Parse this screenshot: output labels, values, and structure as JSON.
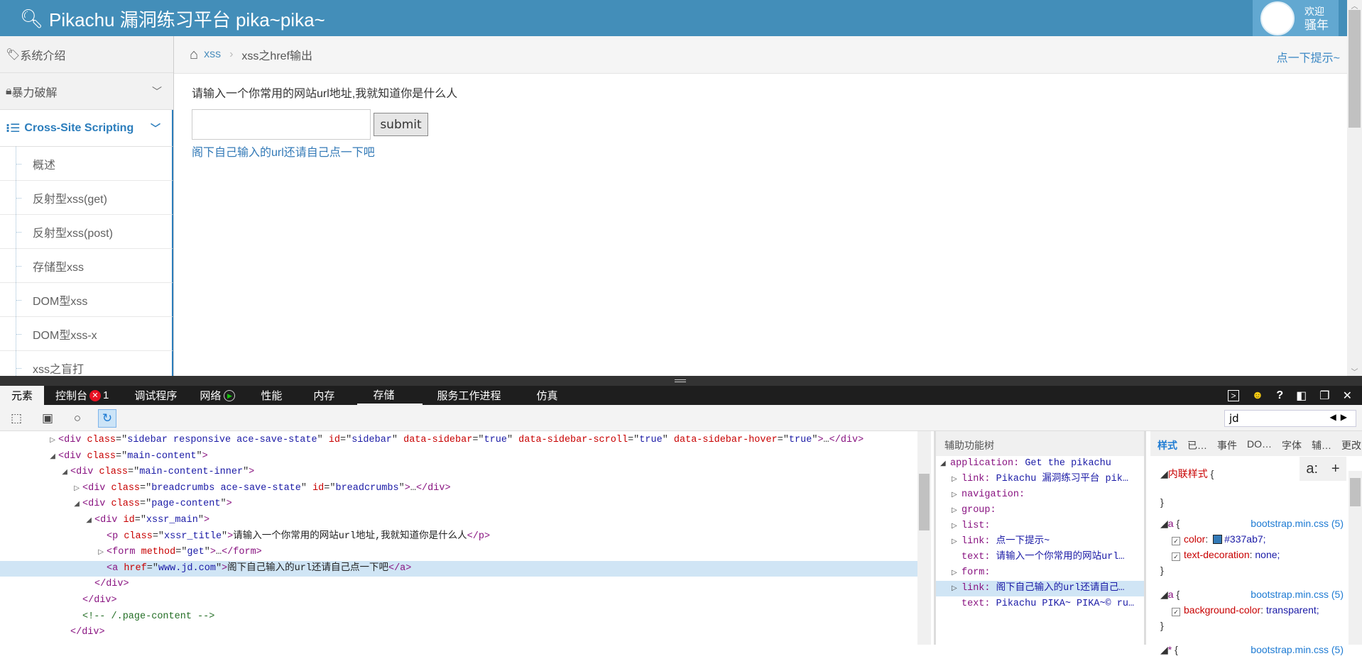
{
  "header": {
    "brand_icon": "key-icon",
    "title": "Pikachu 漏洞练习平台 pika~pika~",
    "user": {
      "avatar_icon": "pikachu-avatar",
      "welcome": "欢迎",
      "name": "骚年"
    }
  },
  "sidebar": {
    "items": [
      {
        "icon": "tag-icon",
        "label": "系统介绍"
      },
      {
        "icon": "lock-icon",
        "label": "暴力破解"
      },
      {
        "icon": "list-icon",
        "label": "Cross-Site Scripting"
      }
    ],
    "subitems": [
      "概述",
      "反射型xss(get)",
      "反射型xss(post)",
      "存储型xss",
      "DOM型xss",
      "DOM型xss-x",
      "xss之盲打"
    ]
  },
  "breadcrumb": {
    "home_icon": "home-icon",
    "parent": "xss",
    "current": "xss之href输出",
    "hint": "点一下提示~"
  },
  "main": {
    "title": "请输入一个你常用的网站url地址,我就知道你是什么人",
    "input_value": "",
    "submit_label": "submit",
    "link_text": "阁下自己输入的url还请自己点一下吧"
  },
  "devtools": {
    "tabs": [
      "元素",
      "控制台",
      "调试程序",
      "网络",
      "性能",
      "内存",
      "存储",
      "服务工作进程",
      "仿真"
    ],
    "error_count": "1",
    "find_value": "jd",
    "dom_lines": [
      {
        "indent": 4,
        "arrow": "▷",
        "html": "<span class='tg'>&lt;div </span><span class='at'>class</span>=\"<span class='av'>sidebar responsive ace-save-state</span>\" <span class='at'>id</span>=\"<span class='av'>sidebar</span>\" <span class='at'>data-sidebar</span>=\"<span class='av'>true</span>\" <span class='at'>data-sidebar-scroll</span>=\"<span class='av'>true</span>\" <span class='at'>data-sidebar-hover</span>=\"<span class='av'>true</span>\"<span class='tg'>&gt;</span>…<span class='tg'>&lt;/div&gt;</span>"
      },
      {
        "indent": 4,
        "arrow": "◢",
        "html": "<span class='tg'>&lt;div </span><span class='at'>class</span>=\"<span class='av'>main-content</span>\"<span class='tg'>&gt;</span>"
      },
      {
        "indent": 5,
        "arrow": "◢",
        "html": "<span class='tg'>&lt;div </span><span class='at'>class</span>=\"<span class='av'>main-content-inner</span>\"<span class='tg'>&gt;</span>"
      },
      {
        "indent": 6,
        "arrow": "▷",
        "html": "<span class='tg'>&lt;div </span><span class='at'>class</span>=\"<span class='av'>breadcrumbs ace-save-state</span>\" <span class='at'>id</span>=\"<span class='av'>breadcrumbs</span>\"<span class='tg'>&gt;</span>…<span class='tg'>&lt;/div&gt;</span>"
      },
      {
        "indent": 6,
        "arrow": "◢",
        "html": "<span class='tg'>&lt;div </span><span class='at'>class</span>=\"<span class='av'>page-content</span>\"<span class='tg'>&gt;</span>"
      },
      {
        "indent": 7,
        "arrow": "◢",
        "html": "<span class='tg'>&lt;div </span><span class='at'>id</span>=\"<span class='av'>xssr_main</span>\"<span class='tg'>&gt;</span>"
      },
      {
        "indent": 8,
        "arrow": "",
        "html": "<span class='tg'>&lt;p </span><span class='at'>class</span>=\"<span class='av'>xssr_title</span>\"<span class='tg'>&gt;</span><span class='tx'>请输入一个你常用的网站url地址,我就知道你是什么人</span><span class='tg'>&lt;/p&gt;</span>"
      },
      {
        "indent": 8,
        "arrow": "▷",
        "html": "<span class='tg'>&lt;form </span><span class='at'>method</span>=\"<span class='av'>get</span>\"<span class='tg'>&gt;</span>…<span class='tg'>&lt;/form&gt;</span>"
      },
      {
        "indent": 8,
        "arrow": "",
        "selected": true,
        "html": "<span class='tg'>&lt;a </span><span class='at'>href</span>=\"<span class='av'>www.jd.com</span>\"<span class='tg'>&gt;</span><span class='tx'>阁下自己输入的url还请自己点一下吧</span><span class='tg'>&lt;/a&gt;</span>"
      },
      {
        "indent": 7,
        "arrow": "",
        "html": "<span class='tg'>&lt;/div&gt;</span>"
      },
      {
        "indent": 6,
        "arrow": "",
        "html": "<span class='tg'>&lt;/div&gt;</span>"
      },
      {
        "indent": 6,
        "arrow": "",
        "html": "<span class='cm'>&lt;!-- /.page-content --&gt;</span>"
      },
      {
        "indent": 5,
        "arrow": "",
        "html": "<span class='tg'>&lt;/div&gt;</span>"
      }
    ],
    "accessibility": {
      "title": "辅助功能树",
      "nodes": [
        {
          "arrow": "◢",
          "role": "application:",
          "value": "Get the pikachu",
          "level": 0
        },
        {
          "arrow": "▷",
          "role": "link:",
          "value": "Pikachu 漏洞练习平台 pik…",
          "level": 1
        },
        {
          "arrow": "▷",
          "role": "navigation:",
          "value": "",
          "level": 1
        },
        {
          "arrow": "▷",
          "role": "group:",
          "value": "",
          "level": 1
        },
        {
          "arrow": "▷",
          "role": "list:",
          "value": "",
          "level": 1
        },
        {
          "arrow": "▷",
          "role": "link:",
          "value": "点一下提示~",
          "level": 1
        },
        {
          "arrow": "",
          "role": "text:",
          "value": "请输入一个你常用的网站url…",
          "level": 1
        },
        {
          "arrow": "▷",
          "role": "form:",
          "value": "",
          "level": 1
        },
        {
          "arrow": "▷",
          "role": "link:",
          "value": "阁下自己输入的url还请自己…",
          "level": 1,
          "selected": true
        },
        {
          "arrow": "",
          "role": "text:",
          "value": "Pikachu PIKA~ PIKA~© ru…",
          "level": 1
        }
      ]
    },
    "styles": {
      "tabs": [
        "样式",
        "已…",
        "事件",
        "DO…",
        "字体",
        "辅…",
        "更改"
      ],
      "inline_label": "内联样式",
      "rules": [
        {
          "selector": "a",
          "source": "bootstrap.min.css (5)",
          "props": [
            {
              "name": "color",
              "value": "#337ab7;",
              "swatch": "#337ab7"
            },
            {
              "name": "text-decoration",
              "value": "none;"
            }
          ]
        },
        {
          "selector": "a",
          "source": "bootstrap.min.css (5)",
          "props": [
            {
              "name": "background-color",
              "value": "transparent;"
            }
          ]
        },
        {
          "selector": "*",
          "source": "bootstrap.min.css (5)",
          "props": []
        }
      ]
    }
  },
  "colors": {
    "header": "#438eb9",
    "accent": "#2b7dbc",
    "link": "#337ab7"
  }
}
